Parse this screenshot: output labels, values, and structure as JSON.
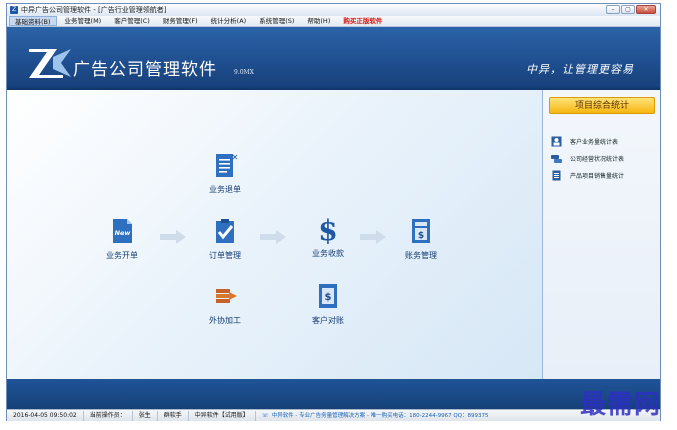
{
  "window": {
    "title": "中异广告公司管理软件 - [广告行业管理领航者]",
    "buttons": {
      "min": "–",
      "max": "▢",
      "close": "✕"
    }
  },
  "menu": [
    {
      "label": "基础资料(B)",
      "active": true
    },
    {
      "label": "业务管理(M)"
    },
    {
      "label": "客户管理(C)"
    },
    {
      "label": "财务管理(F)"
    },
    {
      "label": "统计分析(A)"
    },
    {
      "label": "系统管理(S)"
    },
    {
      "label": "帮助(H)"
    },
    {
      "label": "购买正版软件",
      "highlight": true
    }
  ],
  "banner": {
    "brand": "广告公司管理软件",
    "version": "9.0MX",
    "slogan": "中异，让管理更容易"
  },
  "flow": {
    "tiles": [
      {
        "id": "open",
        "label": "业务开单",
        "icon": "new-document-icon"
      },
      {
        "id": "refund",
        "label": "业务退单",
        "icon": "cancel-document-icon"
      },
      {
        "id": "order",
        "label": "订单管理",
        "icon": "checked-clipboard-icon"
      },
      {
        "id": "outsource",
        "label": "外协加工",
        "icon": "stacked-books-icon"
      },
      {
        "id": "receipt",
        "label": "业务收款",
        "icon": "dollar-icon"
      },
      {
        "id": "reconcile",
        "label": "客户对账",
        "icon": "account-sheet-icon"
      },
      {
        "id": "finance",
        "label": "账务管理",
        "icon": "ledger-icon"
      }
    ]
  },
  "side": {
    "header": "项目综合统计",
    "items": [
      {
        "label": "客户业务量统计表",
        "icon": "person-card-icon"
      },
      {
        "label": "公司经营状况统计表",
        "icon": "cars-icon"
      },
      {
        "label": "产品项目销售量统计",
        "icon": "document-icon"
      }
    ]
  },
  "status": {
    "datetime": "2016-04-05 09:50:02",
    "operator_label": "当前操作员：",
    "operator": "张生",
    "dept": "群软手",
    "edition": "中异软件【试用版】",
    "ad": "中异软件 - 专业广告务量管理解决方案 - 唯一购买电话：180-2244-9967 QQ：899375"
  },
  "watermark": "最需网",
  "colors": {
    "banner": "#1f4f90",
    "accent": "#f5b50f",
    "tile_label": "#163c73",
    "buy": "#d2140d"
  }
}
